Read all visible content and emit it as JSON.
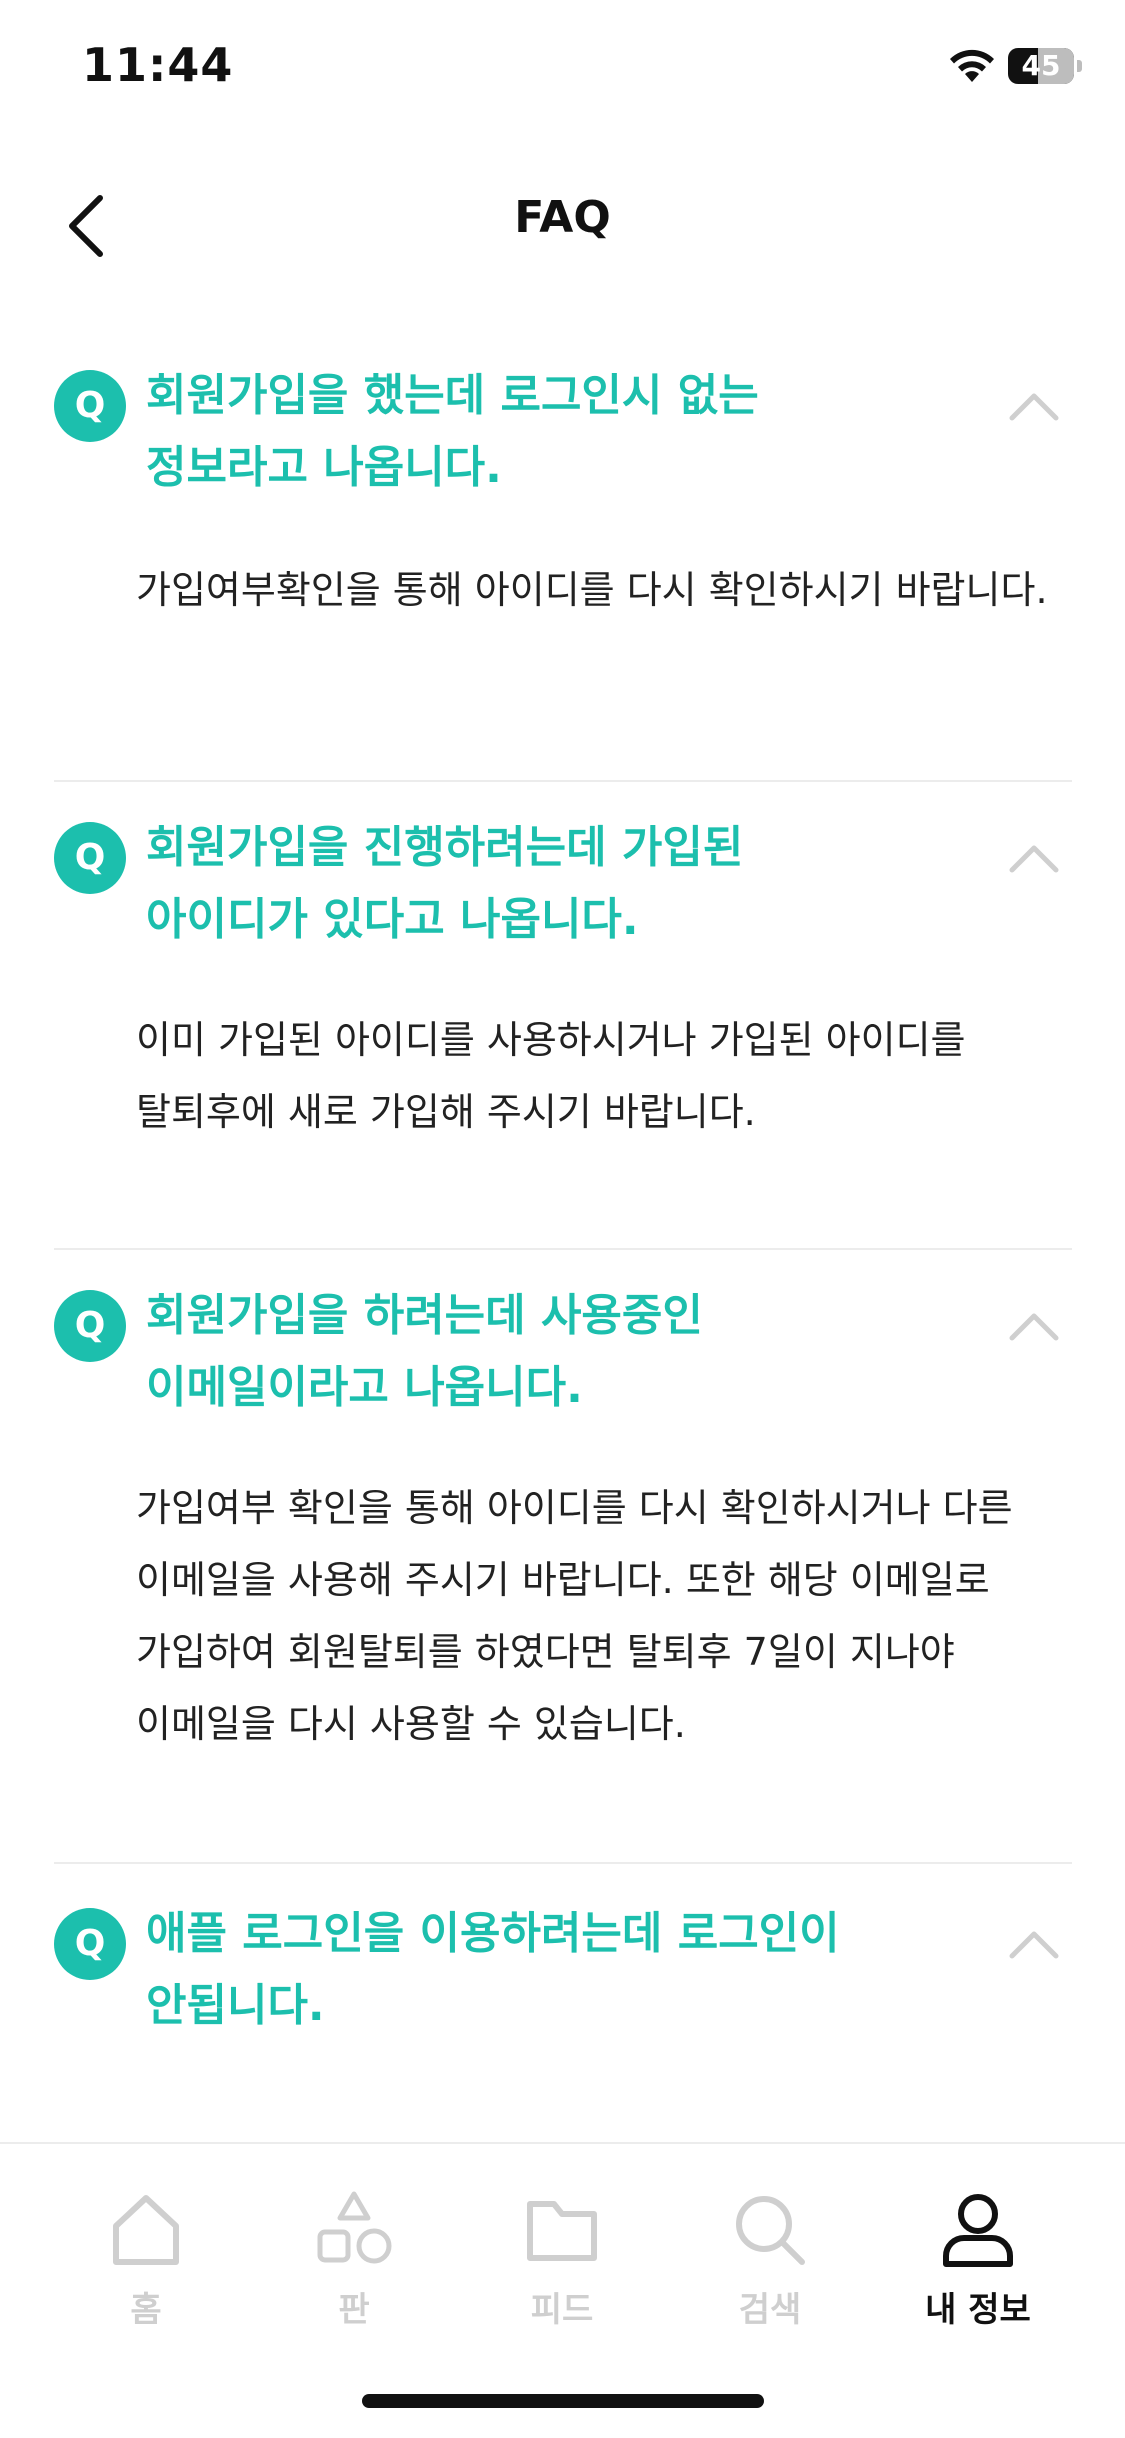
{
  "status_bar": {
    "time": "11:44",
    "battery_level": "45",
    "wifi_icon": "wifi-icon",
    "battery_icon": "battery-icon"
  },
  "header": {
    "title": "FAQ",
    "back_icon": "chevron-left-icon"
  },
  "faq": {
    "badge": "Q",
    "items": [
      {
        "question": "회원가입을 했는데 로그인시 없는 정보라고 나옵니다.",
        "answer": "가입여부확인을 통해 아이디를 다시 확인하시기 바랍니다.",
        "expanded": true
      },
      {
        "question": "회원가입을 진행하려는데 가입된 아이디가 있다고 나옵니다.",
        "answer": "이미 가입된 아이디를 사용하시거나 가입된 아이디를 탈퇴후에 새로 가입해 주시기 바랍니다.",
        "expanded": true
      },
      {
        "question": "회원가입을 하려는데 사용중인 이메일이라고 나옵니다.",
        "answer": "가입여부 확인을 통해 아이디를 다시 확인하시거나 다른 이메일을 사용해 주시기 바랍니다. 또한 해당 이메일로 가입하여 회원탈퇴를 하였다면 탈퇴후 7일이 지나야 이메일을 다시 사용할 수 있습니다.",
        "expanded": true
      },
      {
        "question": "애플 로그인을 이용하려는데 로그인이 안됩니다.",
        "answer": "",
        "expanded": true
      }
    ]
  },
  "bottom_nav": {
    "items": [
      {
        "label": "홈",
        "icon": "home-icon",
        "active": false
      },
      {
        "label": "판",
        "icon": "shapes-icon",
        "active": false
      },
      {
        "label": "피드",
        "icon": "folder-icon",
        "active": false
      },
      {
        "label": "검색",
        "icon": "search-icon",
        "active": false
      },
      {
        "label": "내 정보",
        "icon": "user-icon",
        "active": true
      }
    ]
  },
  "colors": {
    "accent": "#1cbfad",
    "inactive": "#cfcfcf",
    "text": "#111111"
  }
}
